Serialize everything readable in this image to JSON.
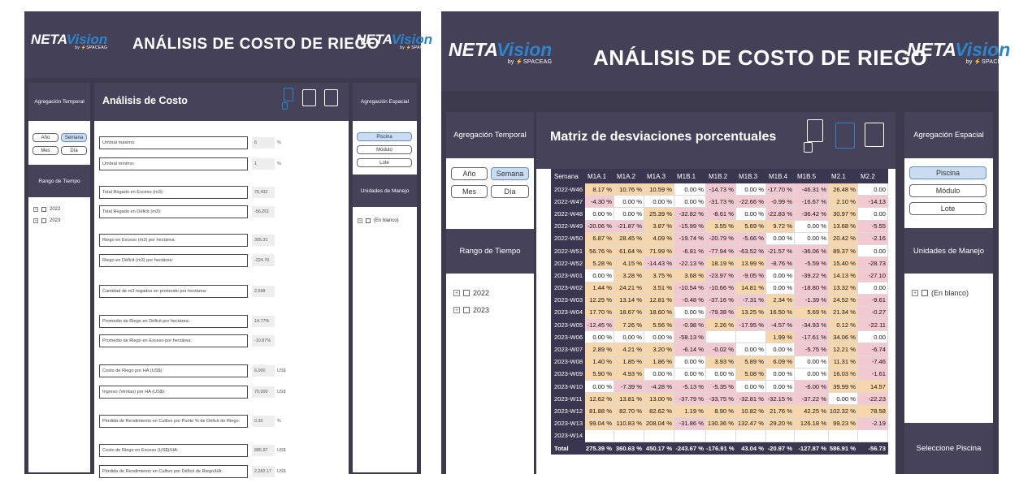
{
  "left": {
    "header_title": "ANÁLISIS DE COSTO DE RIEGO",
    "logo": {
      "a": "NETA",
      "b": "Vision",
      "by": "by ⚡SPACEAG"
    },
    "temporal": {
      "title": "Agregación Temporal",
      "buttons": [
        "Año",
        "Semana",
        "Mes",
        "Día"
      ],
      "selected": "Semana"
    },
    "rango": {
      "title": "Rango de Tiempo",
      "years": [
        "2022",
        "2023"
      ]
    },
    "main_title": "Análisis de Costo",
    "spatial": {
      "title": "Agregación Espacial",
      "buttons": [
        "Piscina",
        "Módulo",
        "Lote"
      ],
      "selected": "Piscina"
    },
    "unidades": {
      "title": "Unidades de Manejo",
      "item": "(En blanco)"
    },
    "rows": [
      {
        "label": "Umbral máximo:",
        "value": "6",
        "unit": "%"
      },
      {
        "label": "Umbral mínimo:",
        "value": "1",
        "unit": "%"
      },
      {
        "label": "Total Regado en Exceso (m3):",
        "value": "76,432",
        "unit": ""
      },
      {
        "label": "Total Regado en Déficit (m3):",
        "value": "-56,251",
        "unit": ""
      },
      {
        "label": "Riego en Exceso (m3) por hectárea:",
        "value": "305.31",
        "unit": ""
      },
      {
        "label": "Riego en Déficit (m3) por hectárea:",
        "value": "-224.70",
        "unit": ""
      },
      {
        "label": "Cantidad de m3 regados en promedio por hectárea:",
        "value": "2,598",
        "unit": ""
      },
      {
        "label": "Promedio de Riego en Déficit por hectárea:",
        "value": "14.77%",
        "unit": ""
      },
      {
        "label": "Promedio de Riego en Exceso por hectárea:",
        "value": "-10.87%",
        "unit": ""
      },
      {
        "label": "Costo de Riego por HA (US$):",
        "value": "6,000",
        "unit": "US$"
      },
      {
        "label": "Ingreso (Ventas) por HA (US$):",
        "value": "70,000",
        "unit": "US$"
      },
      {
        "label": "Pérdida de Rendimiento en Cultivo por Punto % de Déficit de Riego:",
        "value": "0.30",
        "unit": "%"
      },
      {
        "label": "Costo de Riego en Exceso (US$)/HA:",
        "value": "885.97",
        "unit": "US$"
      },
      {
        "label": "Pérdida de Rendimiento en Cultivo por Déficit de Riego/HA:",
        "value": "2,282.17",
        "unit": "US$"
      }
    ]
  },
  "right": {
    "header_title": "ANÁLISIS DE COSTO DE RIEGO",
    "logo": {
      "a": "NETA",
      "b": "Vision",
      "by": "by ⚡SPACEAG"
    },
    "temporal": {
      "title": "Agregación Temporal",
      "buttons": [
        "Año",
        "Semana",
        "Mes",
        "Día"
      ],
      "selected": "Semana"
    },
    "rango": {
      "title": "Rango de Tiempo",
      "years": [
        "2022",
        "2023"
      ]
    },
    "main_title": "Matriz de desviaciones porcentuales",
    "spatial": {
      "title": "Agregación Espacial",
      "buttons": [
        "Piscina",
        "Módulo",
        "Lote"
      ],
      "selected": "Piscina"
    },
    "unidades": {
      "title": "Unidades de Manejo",
      "item": "(En blanco)"
    },
    "seleccione": "Seleccione Piscina",
    "matrix": {
      "columns": [
        "Semana",
        "M1A.1",
        "M1A.2",
        "M1A.3",
        "M1B.1",
        "M1B.2",
        "M1B.3",
        "M1B.4",
        "M1B.5",
        "M2.1",
        "M2.2"
      ],
      "rows": [
        [
          "2022-W46",
          "8.17 %",
          "10.76 %",
          "10.59 %",
          "0.00 %",
          "-14.73 %",
          "0.00 %",
          "-17.70 %",
          "-46.31 %",
          "26.48 %",
          "0.00"
        ],
        [
          "2022-W47",
          "-4.30 %",
          "0.00 %",
          "0.00 %",
          "0.00 %",
          "-31.73 %",
          "-22.66 %",
          "-0.99 %",
          "-16.67 %",
          "2.10 %",
          "-14.13"
        ],
        [
          "2022-W48",
          "0.00 %",
          "0.00 %",
          "25.39 %",
          "-32.82 %",
          "-8.61 %",
          "0.00 %",
          "-22.83 %",
          "-36.42 %",
          "30.97 %",
          "0.00"
        ],
        [
          "2022-W49",
          "-20.06 %",
          "-21.87 %",
          "3.87 %",
          "-15.99 %",
          "3.55 %",
          "5.69 %",
          "9.72 %",
          "0.00 %",
          "13.68 %",
          "-5.55"
        ],
        [
          "2022-W50",
          "6.87 %",
          "28.45 %",
          "4.09 %",
          "-19.74 %",
          "-20.79 %",
          "-5.66 %",
          "0.00 %",
          "0.00 %",
          "20.42 %",
          "-2.16"
        ],
        [
          "2022-W51",
          "56.76 %",
          "61.64 %",
          "71.99 %",
          "-6.81 %",
          "-77.94 %",
          "-63.52 %",
          "-21.57 %",
          "-36.06 %",
          "89.37 %",
          "0.00"
        ],
        [
          "2022-W52",
          "5.28 %",
          "4.15 %",
          "-14.43 %",
          "-22.13 %",
          "18.19 %",
          "13.99 %",
          "-8.76 %",
          "-5.59 %",
          "15.40 %",
          "-28.73"
        ],
        [
          "2023-W01",
          "0.00 %",
          "3.28 %",
          "3.75 %",
          "3.68 %",
          "-23.97 %",
          "-9.05 %",
          "0.00 %",
          "-39.22 %",
          "14.13 %",
          "-27.10"
        ],
        [
          "2023-W02",
          "1.44 %",
          "24.21 %",
          "3.51 %",
          "-10.54 %",
          "-10.66 %",
          "14.81 %",
          "0.00 %",
          "-18.80 %",
          "13.32 %",
          "0.00"
        ],
        [
          "2023-W03",
          "12.25 %",
          "13.14 %",
          "12.81 %",
          "-0.48 %",
          "-37.16 %",
          "-7.31 %",
          "2.34 %",
          "-1.39 %",
          "24.52 %",
          "-9.61"
        ],
        [
          "2023-W04",
          "17.70 %",
          "18.67 %",
          "18.60 %",
          "0.00 %",
          "-79.38 %",
          "13.25 %",
          "16.50 %",
          "5.69 %",
          "21.34 %",
          "-0.27"
        ],
        [
          "2023-W05",
          "-12.45 %",
          "7.26 %",
          "5.56 %",
          "-0.98 %",
          "2.26 %",
          "-17.95 %",
          "-4.57 %",
          "-34.93 %",
          "0.12 %",
          "-22.11"
        ],
        [
          "2023-W06",
          "0.00 %",
          "0.00 %",
          "0.00 %",
          "-58.13 %",
          "",
          "",
          "1.99 %",
          "-17.61 %",
          "34.06 %",
          "0.00"
        ],
        [
          "2023-W07",
          "2.89 %",
          "4.21 %",
          "3.20 %",
          "-6.14 %",
          "-0.02 %",
          "0.00 %",
          "0.00 %",
          "-5.75 %",
          "12.21 %",
          "-6.74"
        ],
        [
          "2023-W08",
          "1.40 %",
          "1.85 %",
          "1.86 %",
          "0.00 %",
          "3.93 %",
          "5.89 %",
          "6.09 %",
          "0.00 %",
          "11.31 %",
          "-7.46"
        ],
        [
          "2023-W09",
          "5.90 %",
          "4.93 %",
          "0.00 %",
          "0.00 %",
          "0.00 %",
          "5.08 %",
          "0.00 %",
          "0.00 %",
          "16.03 %",
          "-1.61"
        ],
        [
          "2023-W10",
          "0.00 %",
          "-7.39 %",
          "-4.28 %",
          "-5.13 %",
          "-5.35 %",
          "0.00 %",
          "0.00 %",
          "-6.00 %",
          "39.99 %",
          "14.57"
        ],
        [
          "2023-W11",
          "12.62 %",
          "13.81 %",
          "13.00 %",
          "-37.79 %",
          "-33.75 %",
          "-32.81 %",
          "-32.15 %",
          "-37.22 %",
          "0.00 %",
          "-22.23"
        ],
        [
          "2023-W12",
          "81.88 %",
          "82.70 %",
          "82.62 %",
          "1.19 %",
          "8.90 %",
          "10.82 %",
          "21.76 %",
          "42.25 %",
          "102.32 %",
          "78.58"
        ],
        [
          "2023-W13",
          "99.04 %",
          "110.83 %",
          "208.04 %",
          "-31.86 %",
          "130.36 %",
          "132.47 %",
          "29.20 %",
          "126.18 %",
          "99.23 %",
          "-2.19"
        ],
        [
          "2023-W14",
          "",
          "",
          "",
          "",
          "",
          "",
          "",
          "",
          "",
          ""
        ]
      ],
      "total": [
        "Total",
        "275.39 %",
        "360.63 %",
        "450.17 %",
        "-243.67 %",
        "-176.91 %",
        "43.04 %",
        "-20.97 %",
        "-127.87 %",
        "586.91 %",
        "-56.73"
      ],
      "colors": {
        "positive": "#f8d6ab",
        "negative": "#f2c9d0",
        "neutral": "#ffffff"
      }
    }
  }
}
